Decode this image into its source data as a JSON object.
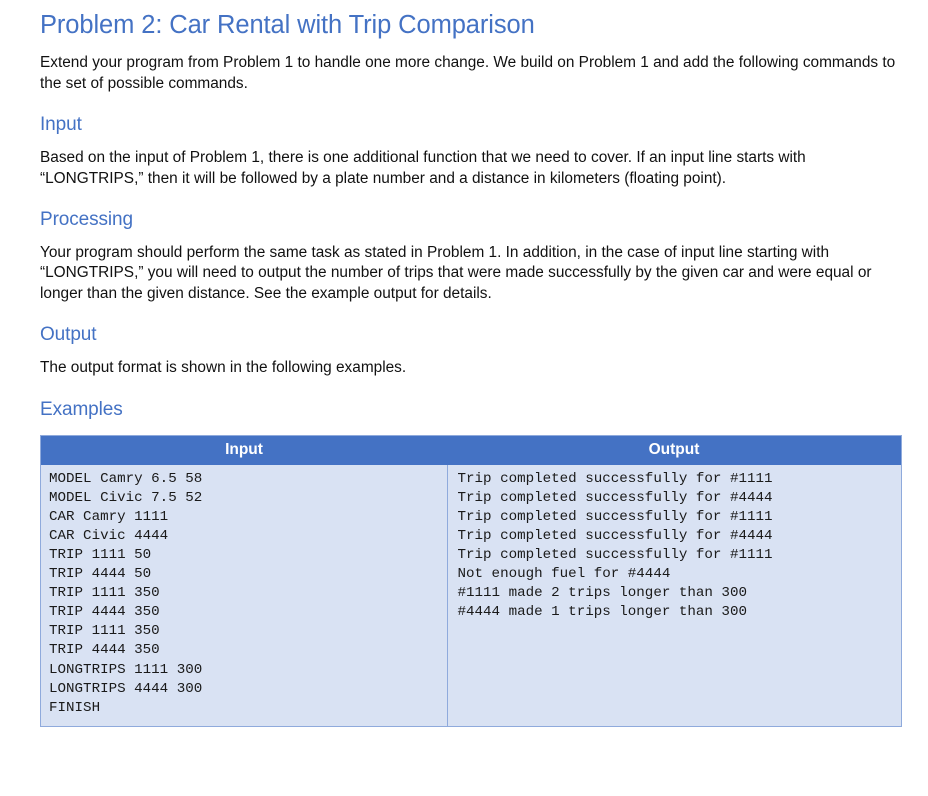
{
  "document": {
    "title": "Problem 2: Car Rental with Trip Comparison",
    "intro_paragraph": "Extend your program from Problem 1 to handle one more change. We build on Problem 1 and add the following commands to the set of possible commands.",
    "sections": {
      "input": {
        "heading": "Input",
        "paragraph": "Based on the input of Problem 1, there is one additional function that we need to cover. If an input line starts with “LONGTRIPS,” then it will be followed by a plate number and a distance in kilometers (floating point)."
      },
      "processing": {
        "heading": "Processing",
        "paragraph": "Your program should perform the same task as stated in Problem 1. In addition, in the case of input line starting with “LONGTRIPS,” you will need to output the number of trips that were made successfully by the given car and were equal or longer than the given distance. See the example output for details."
      },
      "output": {
        "heading": "Output",
        "paragraph": "The output format is shown in the following examples."
      },
      "examples": {
        "heading": "Examples"
      }
    }
  },
  "examples_table": {
    "headers": {
      "input": "Input",
      "output": "Output"
    },
    "input_lines": [
      "MODEL Camry 6.5 58",
      "MODEL Civic 7.5 52",
      "CAR Camry 1111",
      "CAR Civic 4444",
      "TRIP 1111 50",
      "TRIP 4444 50",
      "TRIP 1111 350",
      "TRIP 4444 350",
      "TRIP 1111 350",
      "TRIP 4444 350",
      "LONGTRIPS 1111 300",
      "LONGTRIPS 4444 300",
      "FINISH"
    ],
    "output_lines": [
      "Trip completed successfully for #1111",
      "Trip completed successfully for #4444",
      "Trip completed successfully for #1111",
      "Trip completed successfully for #4444",
      "Trip completed successfully for #1111",
      "Not enough fuel for #4444",
      "#1111 made 2 trips longer than 300",
      "#4444 made 1 trips longer than 300"
    ]
  },
  "colors": {
    "heading_blue": "#4472C4",
    "table_header_bg": "#4472C4",
    "table_cell_bg": "#D9E2F3",
    "table_border": "#8FAADC",
    "body_text": "#111111"
  }
}
